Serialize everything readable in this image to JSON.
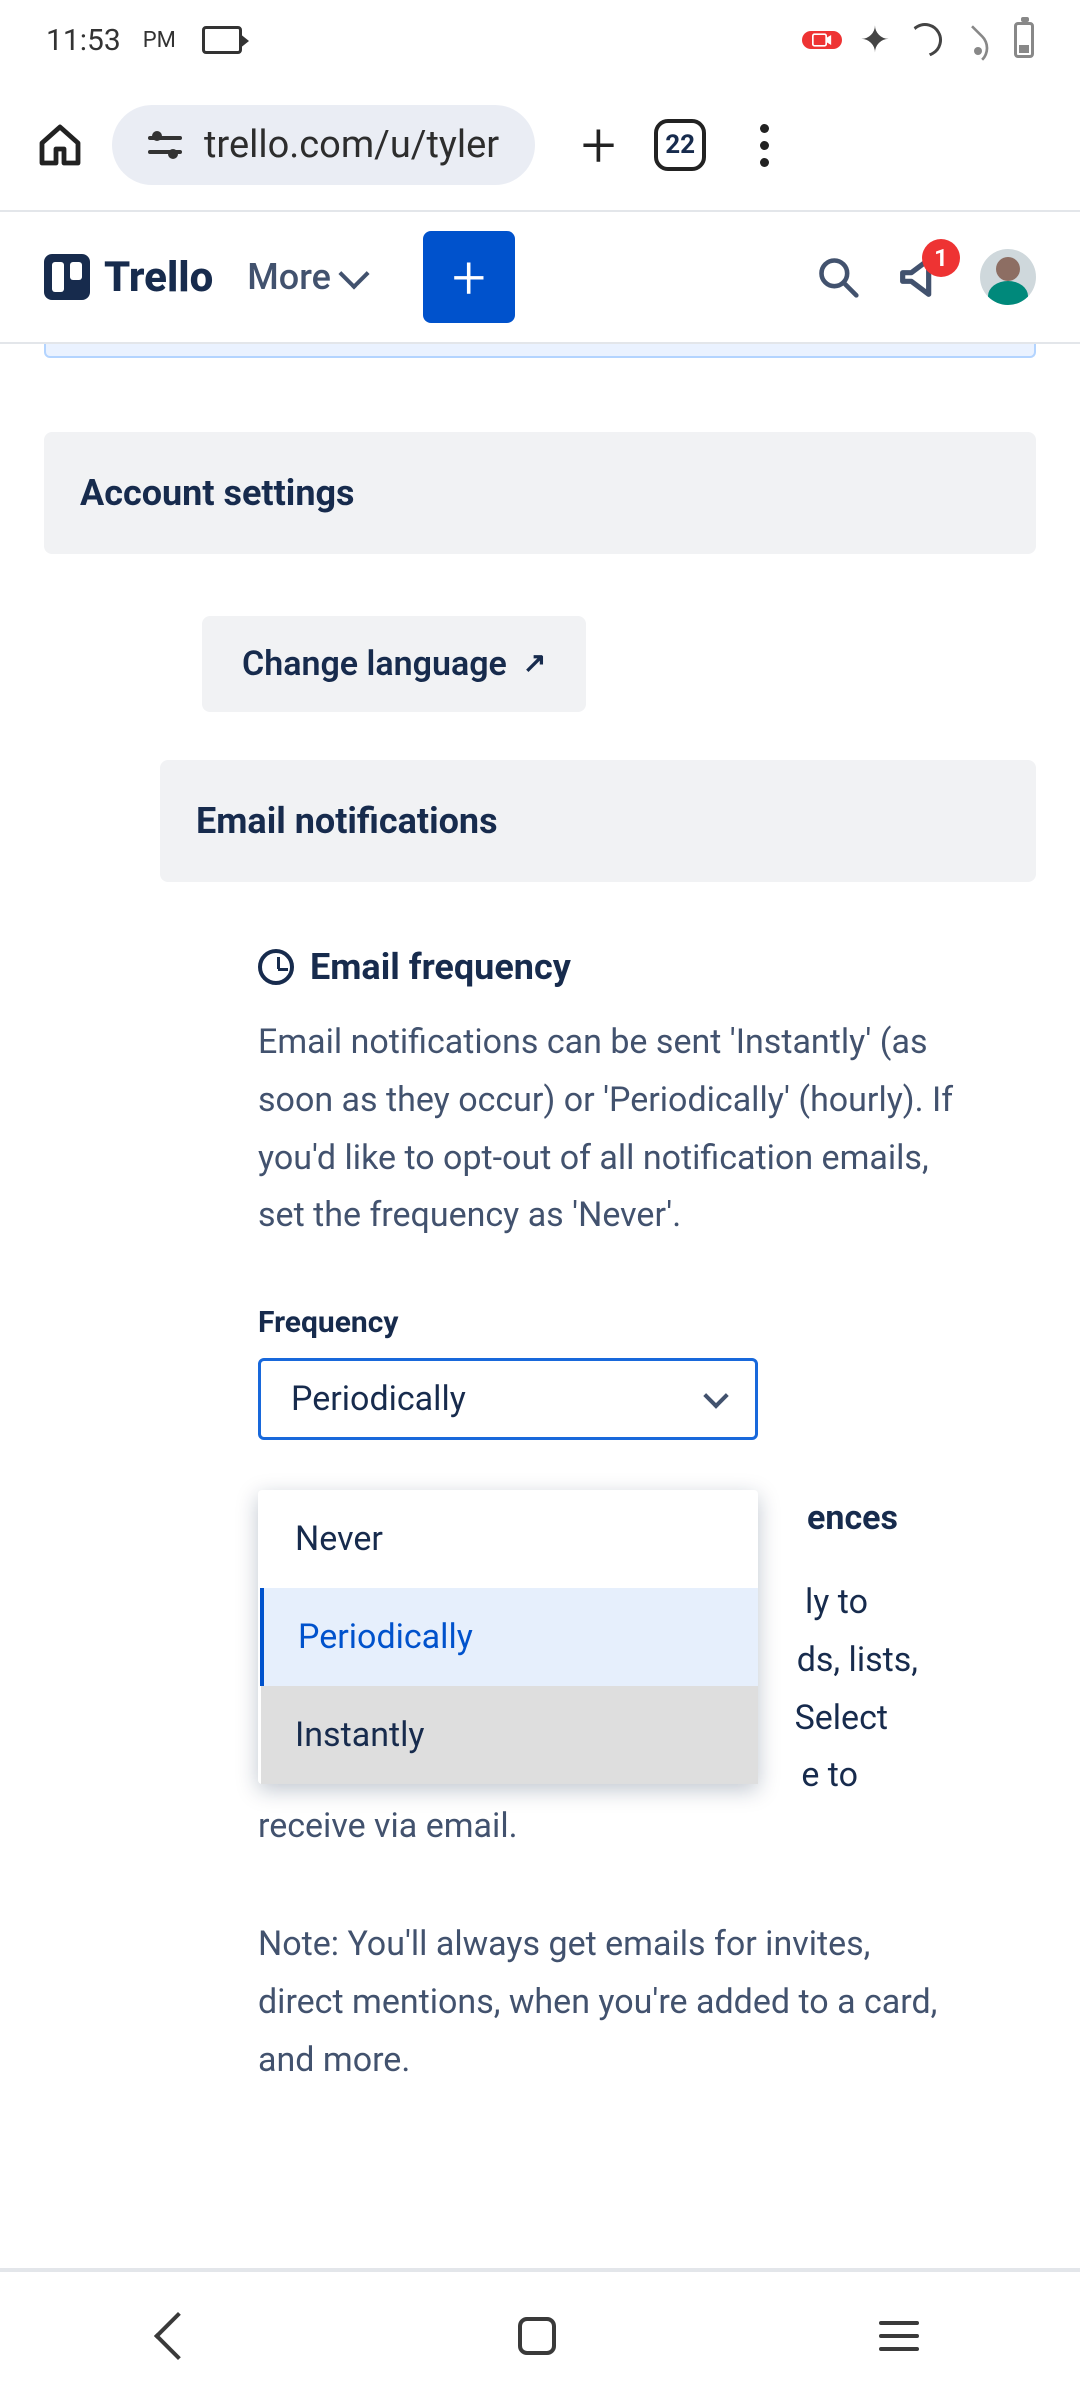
{
  "status": {
    "time": "11:53",
    "ampm": "PM"
  },
  "browser": {
    "url": "trello.com/u/tyler",
    "tab_count": "22"
  },
  "header": {
    "brand": "Trello",
    "more_label": "More",
    "notif_count": "1"
  },
  "sections": {
    "account_settings": "Account settings",
    "change_language": "Change language",
    "email_notifications": "Email notifications"
  },
  "email_freq": {
    "title": "Email frequency",
    "desc": "Email notifications can be sent 'Instantly' (as soon as they occur) or 'Periodically' (hourly). If you'd like to opt-out of all notification emails, set the frequency as 'Never'.",
    "field_label": "Frequency",
    "selected": "Periodically",
    "options": [
      "Never",
      "Periodically",
      "Instantly"
    ]
  },
  "prefs": {
    "heading_fragment": "ences",
    "line1_fragment": "ly to",
    "line2_fragment": "ds, lists,",
    "line3_fragment": "Select",
    "line4_fragment": "e to",
    "visible_tail": "receive via email.",
    "note": "Note: You'll always get emails for invites, direct mentions, when you're added to a card, and more."
  }
}
